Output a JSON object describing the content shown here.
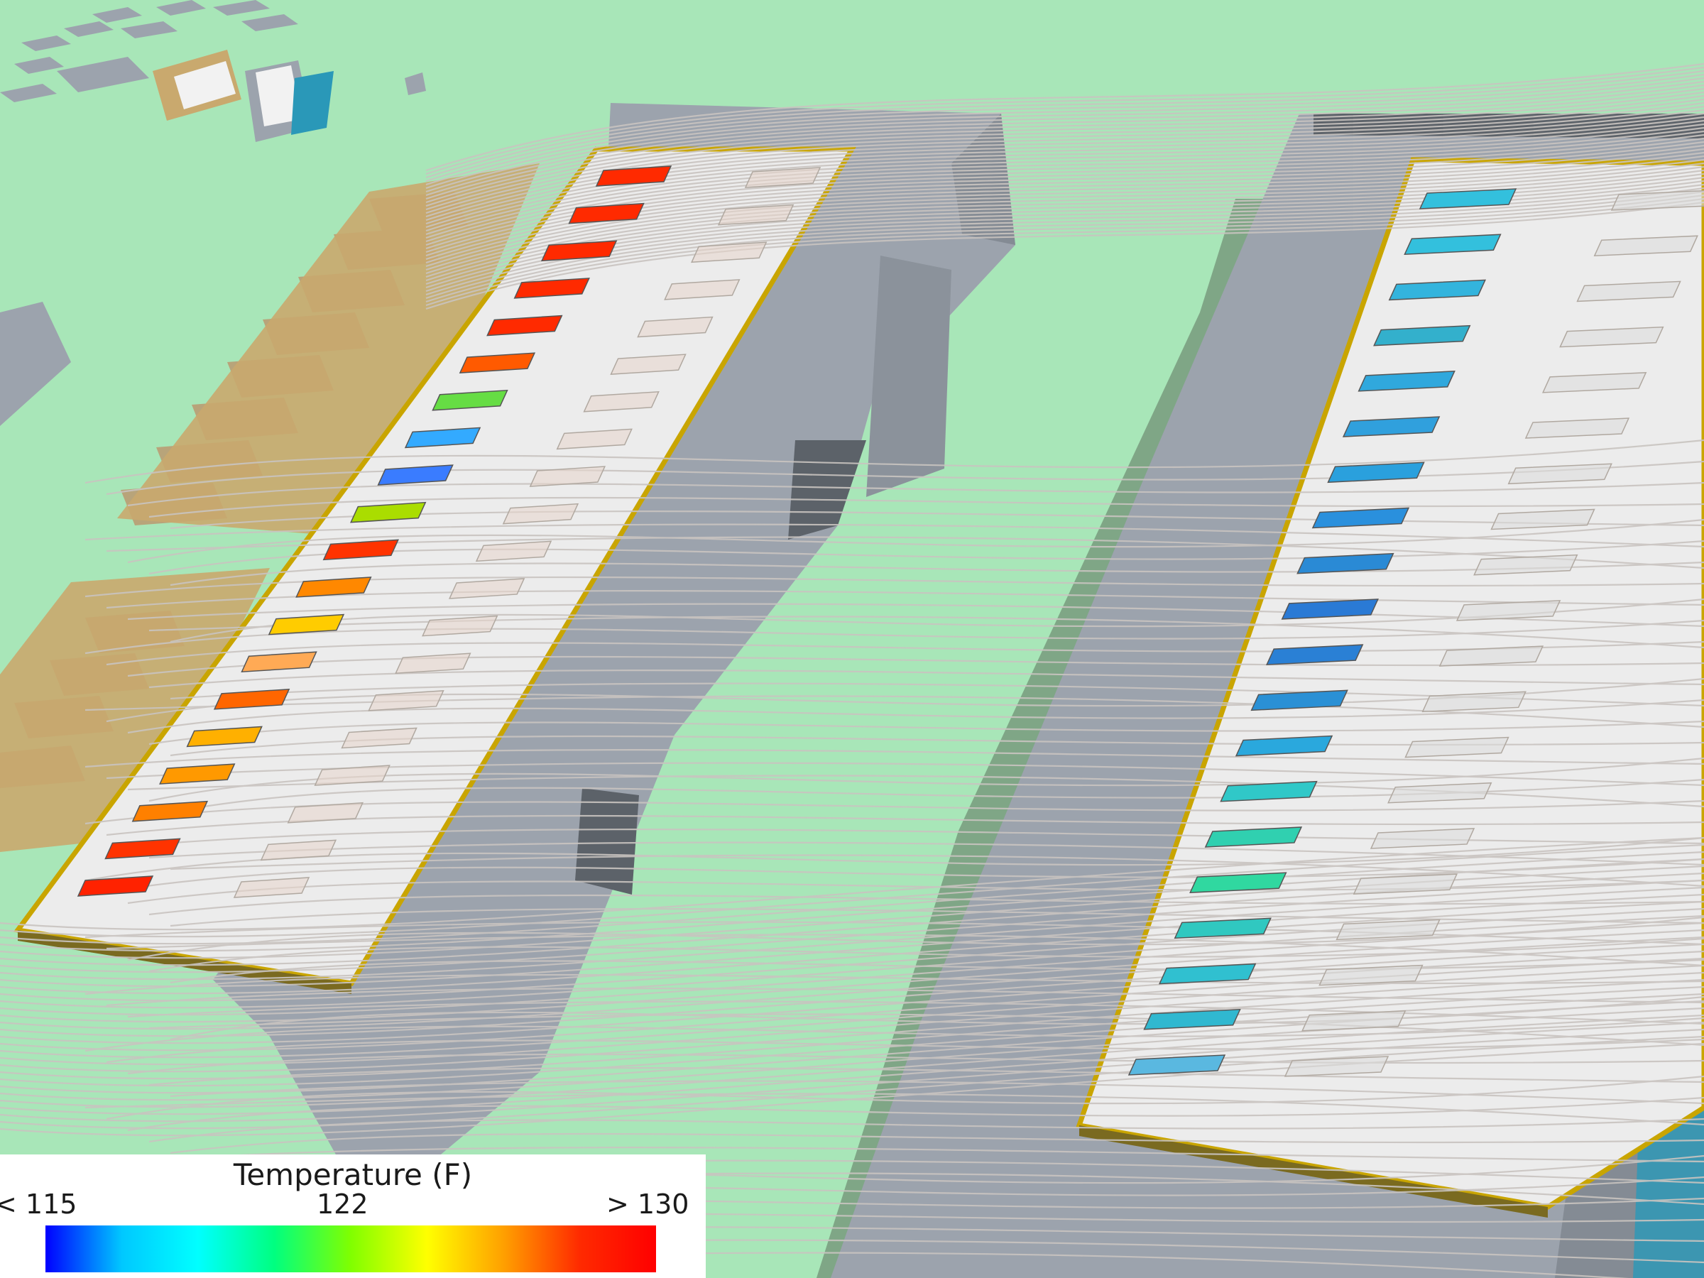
{
  "legend": {
    "title": "Temperature (F)",
    "min_label": "< 115",
    "mid_label": "122",
    "max_label": "> 130",
    "colors": [
      "#0000ff",
      "#00c8ff",
      "#00ffff",
      "#00ff80",
      "#80ff00",
      "#ffff00",
      "#ffa000",
      "#ff2a00",
      "#ff0000"
    ]
  },
  "scene": {
    "ground_color": "#a8e6b8",
    "building_color": "#9ca3ad",
    "roof_color": "#ececec",
    "trim_color": "#c9a500",
    "left_units": [
      "#ff2a00",
      "#ff2a00",
      "#ff2a00",
      "#ff2a00",
      "#ff2a00",
      "#ff5a00",
      "#66dd44",
      "#33aaff",
      "#3a7cff",
      "#aadd00",
      "#ff3300",
      "#ff8800",
      "#ffcc00",
      "#ffaa55",
      "#ff6600",
      "#ffb000",
      "#ff9900",
      "#ff8000",
      "#ff3300",
      "#ff2200"
    ],
    "right_units": [
      "#33c0dd",
      "#33c0dd",
      "#33b4dd",
      "#33b0cc",
      "#30a8dd",
      "#30a0dd",
      "#2aa0dd",
      "#2a90dd",
      "#2a8ad5",
      "#2a7ad5",
      "#2a80d5",
      "#2a90d5",
      "#2aa8dd",
      "#30c8c8",
      "#30d0b0",
      "#30d8a0",
      "#30c8c0",
      "#30c0d0",
      "#30b8d0",
      "#5ab8e0"
    ]
  }
}
